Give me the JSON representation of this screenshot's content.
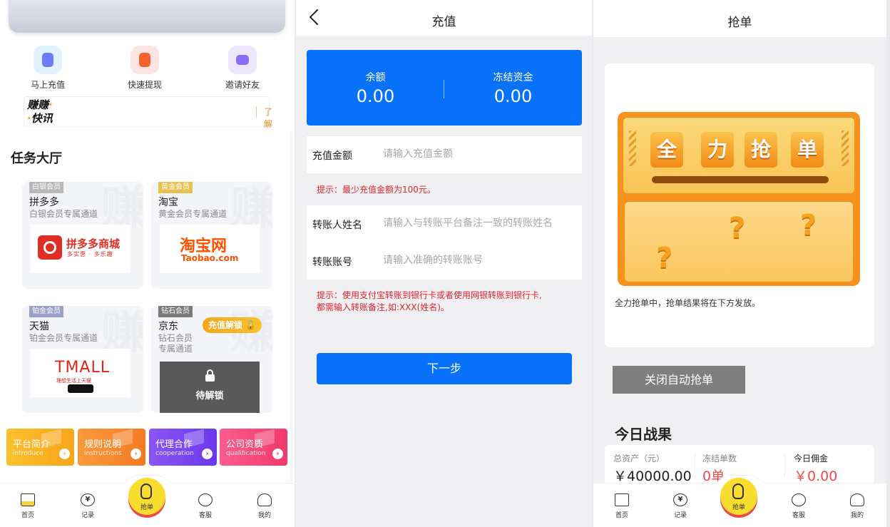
{
  "home": {
    "quick_actions": [
      {
        "label": "马上充值",
        "color": "#7ec8f4"
      },
      {
        "label": "快速提现",
        "color": "#fbb4b4"
      },
      {
        "label": "邀请好友",
        "color": "#c6b8f8"
      }
    ],
    "notice": {
      "logo_line1": "赚赚",
      "logo_line2": "快讯",
      "link": "了解"
    },
    "section_title": "任务大厅",
    "tasks": [
      {
        "tag": "白银会员",
        "tag_color": "#b9b9b9",
        "name": "拼多多",
        "sub": "白银会员专属通道",
        "logo_main": "拼多多商城",
        "logo_sub": "多实惠 · 多乐趣"
      },
      {
        "tag": "黄金会员",
        "tag_color": "#e8c250",
        "name": "淘宝",
        "sub": "黄金会员专属通道",
        "logo_main": "淘宝网",
        "logo_sub": "Taobao.com"
      },
      {
        "tag": "铂金会员",
        "tag_color": "#9aa0c8",
        "name": "天猫",
        "sub": "铂金会员专属通道",
        "logo_main": "TMALL",
        "logo_sub": "理想生活上天猫"
      },
      {
        "tag": "钻石会员",
        "tag_color": "#7a7a7a",
        "name": "京东",
        "sub": "钻石会员\n专属通道",
        "badge": "充值解锁",
        "locked_text": "待解锁"
      }
    ],
    "info_cards": [
      {
        "title": "平台简介",
        "sub": "introduce",
        "color_from": "#fbc02d",
        "color_to": "#f8a51b"
      },
      {
        "title": "规则说明",
        "sub": "instructions",
        "color_from": "#fb9a3c",
        "color_to": "#f47a22"
      },
      {
        "title": "代理合作",
        "sub": "cooperation",
        "color_from": "#8a55f5",
        "color_to": "#6a38ea"
      },
      {
        "title": "公司资质",
        "sub": "qualification",
        "color_from": "#fb5d8d",
        "color_to": "#f2386b"
      }
    ]
  },
  "tabbar": {
    "home": "首页",
    "records": "记录",
    "grab": "抢单",
    "service": "客服",
    "mine": "我的",
    "records_icon_glyph": "¥"
  },
  "recharge": {
    "title": "充值",
    "balance_label": "余额",
    "balance_value": "0.00",
    "frozen_label": "冻结资金",
    "frozen_value": "0.00",
    "amount_label": "充值金额",
    "amount_placeholder": "请输入充值金额",
    "hint1": "提示：最少充值金额为100元。",
    "name_label": "转账人姓名",
    "name_placeholder": "请输入与转账平台备注一致的转账姓名",
    "account_label": "转账账号",
    "account_placeholder": "请输入准确的转账账号",
    "hint2_line1": "提示：使用支付宝转账到银行卡或者使用网银转账到银行卡,",
    "hint2_line2": "都需输入转账备注,如:XXX(姓名)。",
    "next": "下一步"
  },
  "grab": {
    "title": "抢单",
    "tiles": [
      "全",
      "力",
      "抢",
      "单"
    ],
    "status_text": "全力抢单中，抢单结果将在下方发放。",
    "close_auto": "关闭自动抢单",
    "today_title": "今日战果",
    "stats": [
      {
        "label": "总资产（元）",
        "value": "￥40000.00",
        "color": "#222222"
      },
      {
        "label": "冻结单数",
        "value": "0单",
        "color": "#f24a4a"
      },
      {
        "label": "今日佣金",
        "value": "￥0.00",
        "color": "#f24a4a"
      }
    ]
  }
}
